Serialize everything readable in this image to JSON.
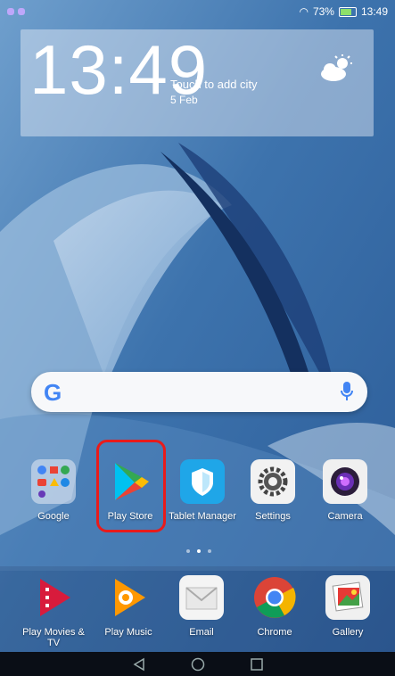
{
  "status": {
    "battery": "73%",
    "time": "13:49"
  },
  "widget": {
    "time": "13:49",
    "city_prompt": "Touch to add city",
    "date": "5 Feb"
  },
  "search": {
    "logo": "G"
  },
  "apps": [
    {
      "label": "Google",
      "icon": "google-folder-icon"
    },
    {
      "label": "Play Store",
      "icon": "play-store-icon"
    },
    {
      "label": "Tablet Manager",
      "icon": "tablet-manager-icon"
    },
    {
      "label": "Settings",
      "icon": "settings-icon"
    },
    {
      "label": "Camera",
      "icon": "camera-icon"
    }
  ],
  "dock": [
    {
      "label": "Play Movies & TV",
      "icon": "play-movies-icon"
    },
    {
      "label": "Play Music",
      "icon": "play-music-icon"
    },
    {
      "label": "Email",
      "icon": "email-icon"
    },
    {
      "label": "Chrome",
      "icon": "chrome-icon"
    },
    {
      "label": "Gallery",
      "icon": "gallery-icon"
    }
  ],
  "colors": {
    "highlight": "#e81b1b",
    "battery": "#8de06a"
  }
}
